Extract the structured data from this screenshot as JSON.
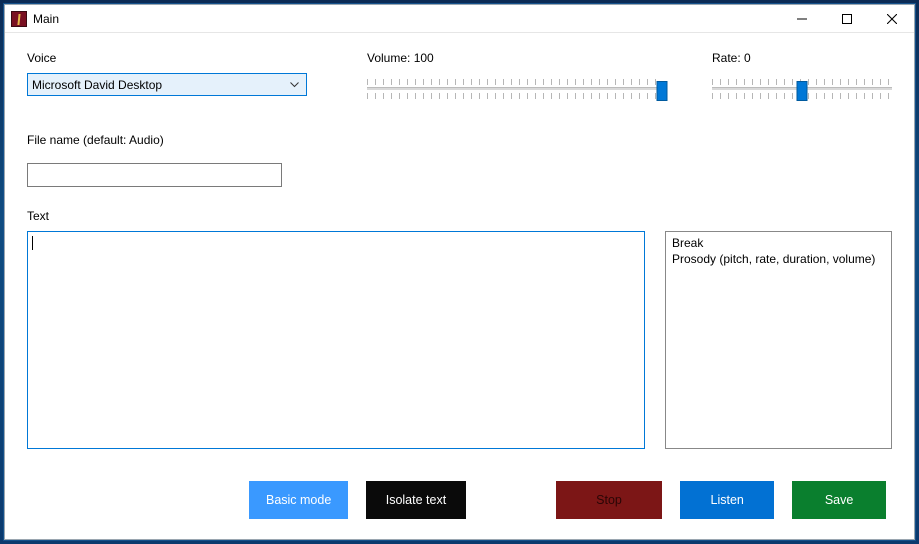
{
  "window": {
    "title": "Main"
  },
  "labels": {
    "voice": "Voice",
    "volume": "Volume: 100",
    "rate": "Rate: 0",
    "filename": "File name (default: Audio)",
    "text": "Text"
  },
  "voice": {
    "selected": "Microsoft David Desktop"
  },
  "sliders": {
    "volume": {
      "min": 0,
      "max": 100,
      "value": 100
    },
    "rate": {
      "min": -10,
      "max": 10,
      "value": 0
    }
  },
  "filename": {
    "value": ""
  },
  "text": {
    "value": ""
  },
  "tags": {
    "line1": "Break",
    "line2": "Prosody (pitch, rate, duration, volume)"
  },
  "buttons": {
    "basic": "Basic mode",
    "isolate": "Isolate text",
    "stop": "Stop",
    "listen": "Listen",
    "save": "Save"
  }
}
